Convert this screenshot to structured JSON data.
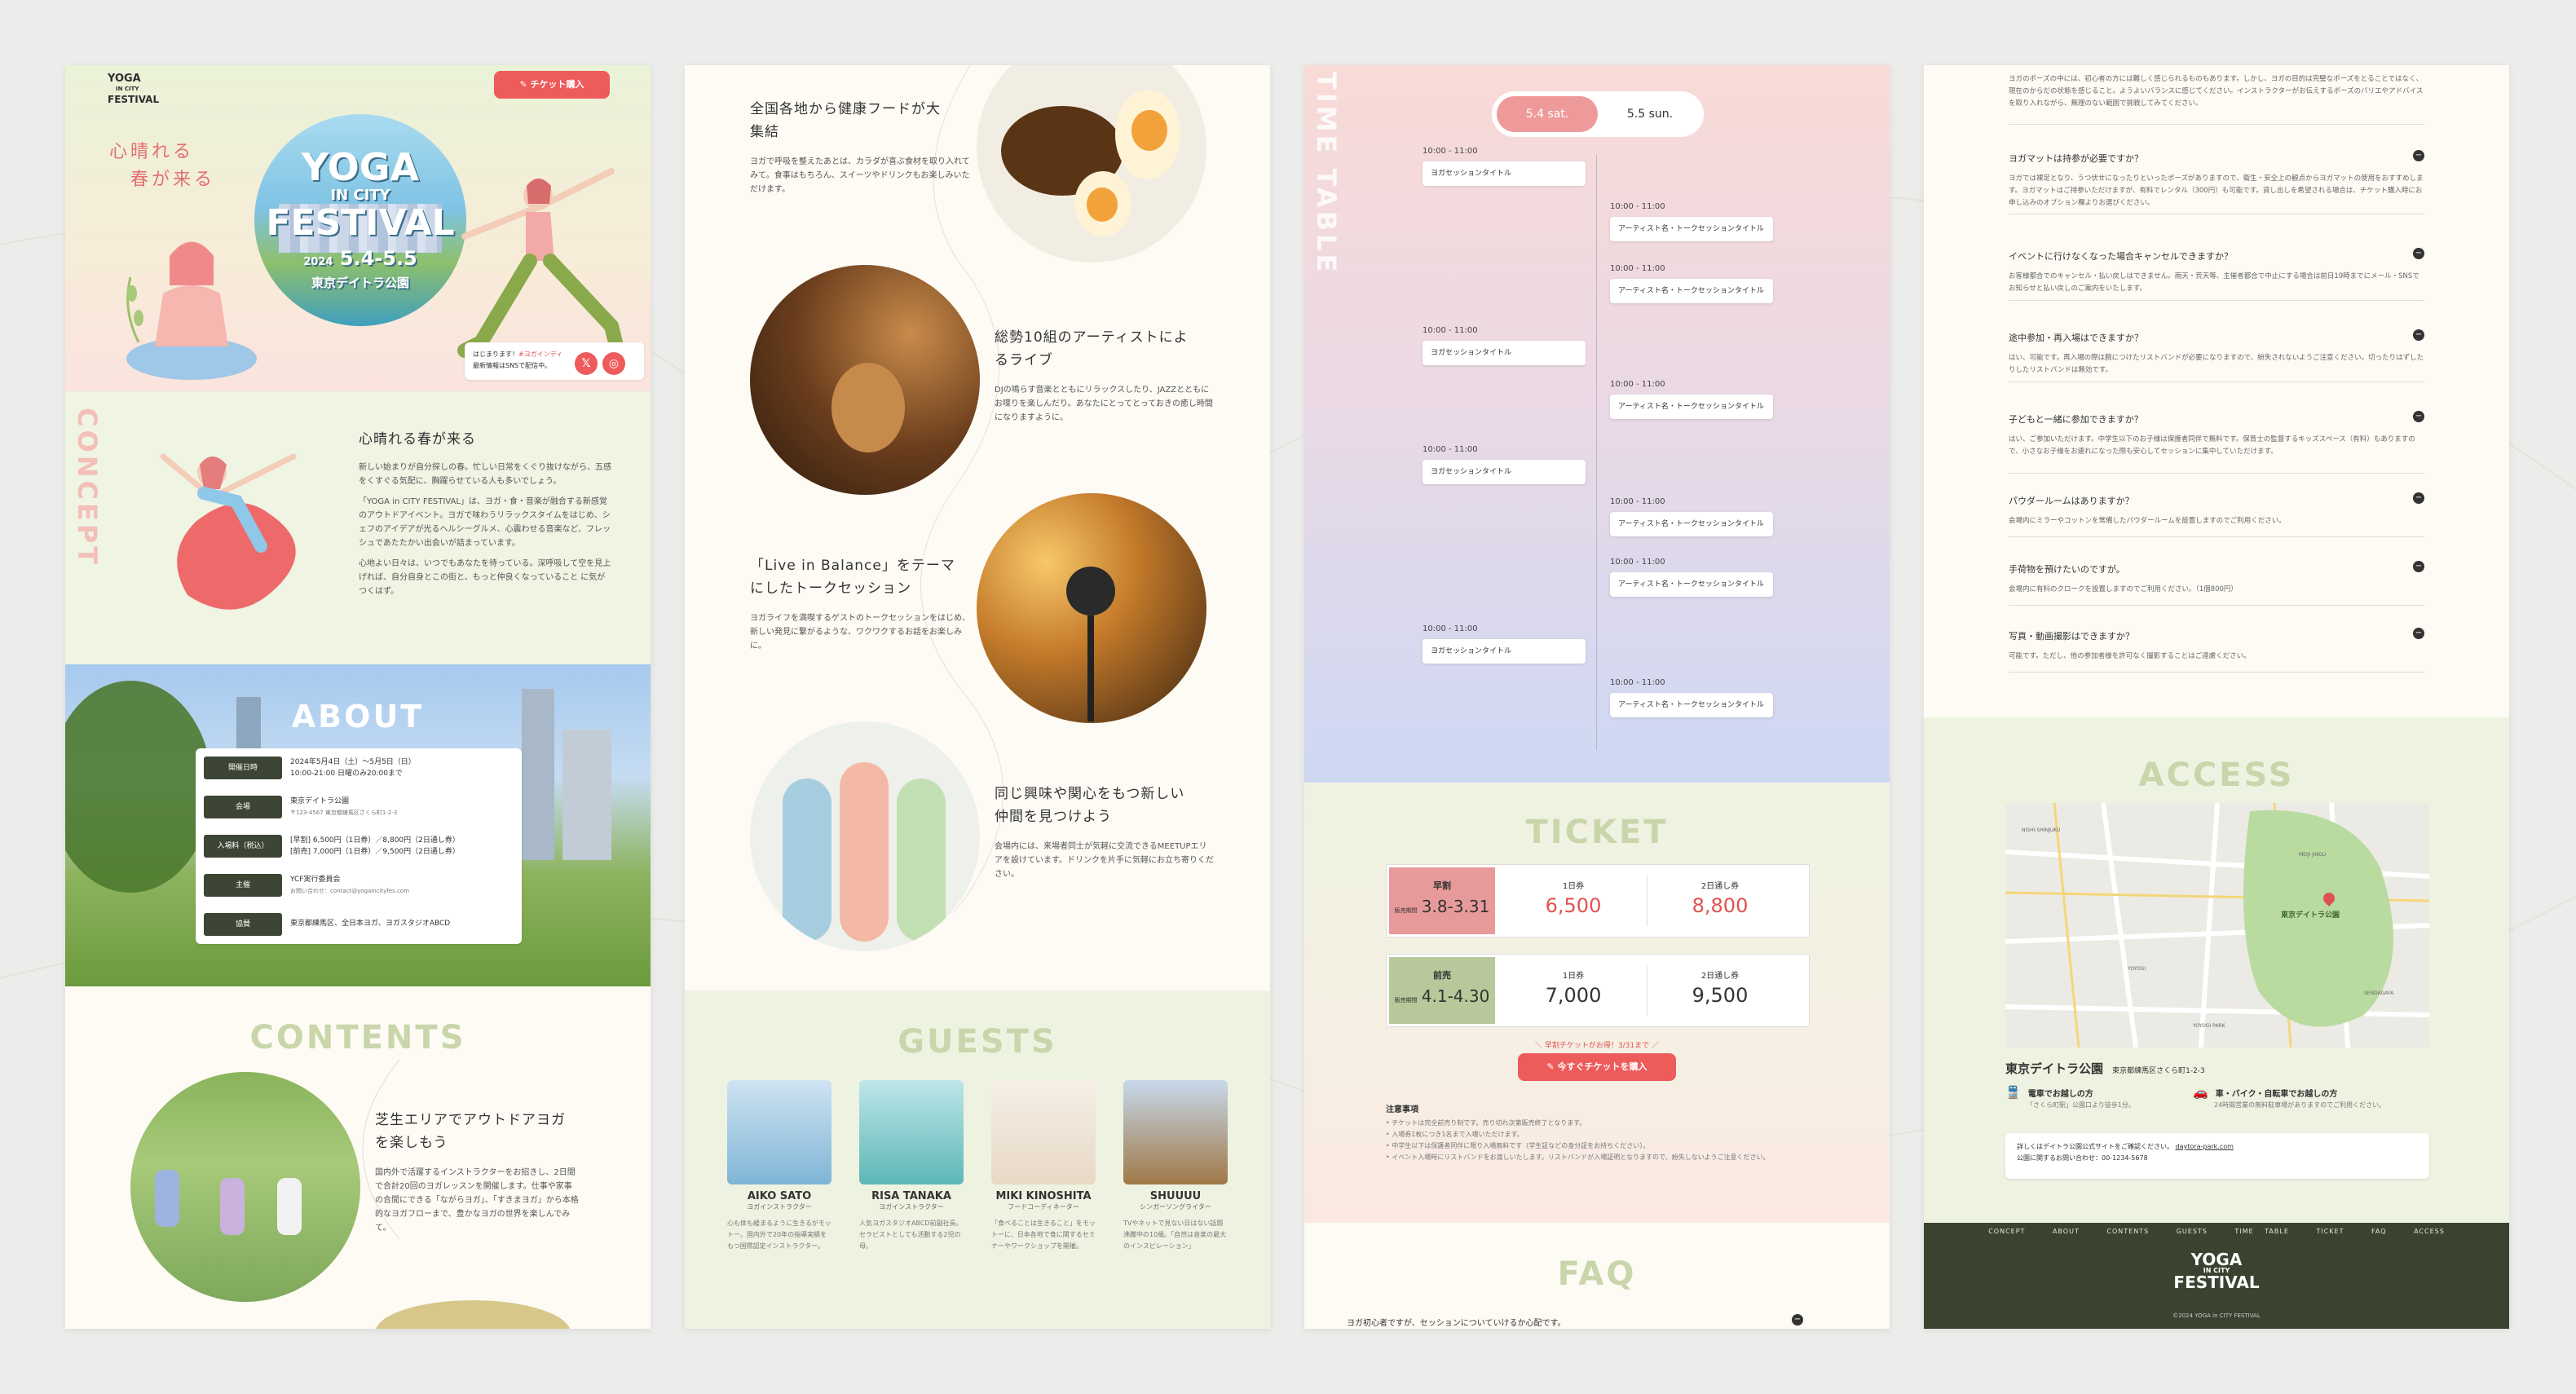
{
  "p1": {
    "logo": {
      "l1": "YOGA",
      "l2": "IN CITY",
      "l3": "FESTIVAL"
    },
    "ticket_button": "チケット購入",
    "hero_tagline": [
      "心晴れる",
      "春が来る"
    ],
    "hero_logo": {
      "l1": "YOGA",
      "l2": "IN CITY",
      "l3": "FESTIVAL",
      "year": "2024",
      "dates": "5.4-5.5",
      "venue": "東京デイトラ公園"
    },
    "news_card": {
      "line1": "はじまります！",
      "link": "#ヨガインディ",
      "line2": "最新情報はSNSで配信中。"
    },
    "concept_vertical": "CONCEPT",
    "concept_title": "心晴れる春が来る",
    "concept_paragraphs": [
      "新しい始まりが自分探しの春。忙しい日常をくぐり抜けながら、五感をくすぐる気配に、胸躍らせている人も多いでしょう。",
      "「YOGA in CITY FESTIVAL」は、ヨガ・食・音楽が融合する新感覚のアウトドアイベント。ヨガで味わうリラックスタイムをはじめ、シェフのアイデアが光るヘルシーグルメ、心震わせる音楽など、フレッシュであたたかい出会いが詰まっています。",
      "心地よい日々は、いつでもあなたを待っている。深呼吸して空を見上げれば、自分自身とこの街と、もっと仲良くなっていること に気がつくはず。"
    ],
    "about_title": "ABOUT",
    "about_rows": [
      {
        "label": "開催日時",
        "value": "2024年5月4日（土）〜5月5日（日）",
        "value2": "10:00-21:00 日曜のみ20:00まで"
      },
      {
        "label": "会場",
        "value": "東京デイトラ公園",
        "value2": "〒123-4567 東京都練馬区さくら町1-2-3"
      },
      {
        "label": "入場料（税込）",
        "value": "[早割] 6,500円（1日券）／8,800円（2日通し券）",
        "value2": "[前売] 7,000円（1日券）／9,500円（2日通し券）"
      },
      {
        "label": "主催",
        "value": "YCF実行委員会",
        "value2": "お問い合わせ：contact@yogaincityfes.com"
      },
      {
        "label": "協賛",
        "value": "東京都練馬区、全日本ヨガ、ヨガスタジオABCD",
        "value2": ""
      }
    ],
    "contents_title": "CONTENTS",
    "contents_item1": {
      "title": [
        "芝生エリアでアウトドアヨガ",
        "を楽しもう"
      ],
      "desc": "国内外で活躍するインストラクターをお招きし、2日間で合計20回のヨガレッスンを開催します。仕事や家事の合間にできる「ながらヨガ」、「すきまヨガ」から本格的なヨガフローまで、豊かなヨガの世界を楽しんでみて。"
    }
  },
  "p2": {
    "items": [
      {
        "title": [
          "全国各地から健康フードが大",
          "集結"
        ],
        "desc": "ヨガで呼吸を整えたあとは、カラダが喜ぶ食材を取り入れてみて。食事はもちろん、スイーツやドリンクもお楽しみいただけます。"
      },
      {
        "title": [
          "総勢10組のアーティストによ",
          "るライブ"
        ],
        "desc": "DJの鳴らす音楽とともにリラックスしたり、JAZZとともにお喋りを楽しんだり。あなたにとってとっておきの癒し時間になりますように。"
      },
      {
        "title": [
          "「Live in Balance」をテーマ",
          "にしたトークセッション"
        ],
        "desc": "ヨガライフを満喫するゲストのトークセッションをはじめ、新しい発見に繋がるような、ワクワクするお話をお楽しみに。"
      },
      {
        "title": [
          "同じ興味や関心をもつ新しい",
          "仲間を見つけよう"
        ],
        "desc": "会場内には、来場者同士が気軽に交流できるMEETUPエリアを設けています。ドリンクを片手に気軽にお立ち寄りください。"
      }
    ],
    "guests_title": "GUESTS",
    "guests": [
      {
        "name": "AIKO SATO",
        "role": "ヨガインストラクター",
        "desc": "心も体も緩まるように生きるがモットー。国内外で20年の指導実績をもつ国際認定インストラクター。"
      },
      {
        "name": "RISA TANAKA",
        "role": "ヨガインストラクター",
        "desc": "人気ヨガスタジオABCD前副社長。セラピストとしても活動する2児の母。"
      },
      {
        "name": "MIKI KINOSHITA",
        "role": "フードコーディネーター",
        "desc": "「食べることは生きること」をモットーに、日本各地で食に関するセミナーやワークショップを開催。"
      },
      {
        "name": "SHUUUU",
        "role": "シンガーソングライター",
        "desc": "TVやネットで見ない日はない話題沸騰中の10歳。「自然は音楽の最大のインスピレーション」"
      }
    ]
  },
  "p3": {
    "timetable_vertical": "TIME TABLE",
    "tabs": [
      "5.4 sat.",
      "5.5 sun."
    ],
    "left_slots": [
      {
        "time": "10:00 - 11:00",
        "title": "ヨガセッションタイトル"
      },
      {
        "time": "10:00 - 11:00",
        "title": "ヨガセッションタイトル"
      },
      {
        "time": "10:00 - 11:00",
        "title": "ヨガセッションタイトル"
      },
      {
        "time": "10:00 - 11:00",
        "title": "ヨガセッションタイトル"
      }
    ],
    "right_slots": [
      {
        "time": "10:00 - 11:00",
        "title": "アーティスト名・トークセッションタイトル"
      },
      {
        "time": "10:00 - 11:00",
        "title": "アーティスト名・トークセッションタイトル"
      },
      {
        "time": "10:00 - 11:00",
        "title": "アーティスト名・トークセッションタイトル"
      },
      {
        "time": "10:00 - 11:00",
        "title": "アーティスト名・トークセッションタイトル"
      },
      {
        "time": "10:00 - 11:00",
        "title": "アーティスト名・トークセッションタイトル"
      },
      {
        "time": "10:00 - 11:00",
        "title": "アーティスト名・トークセッションタイトル"
      }
    ],
    "ticket_title": "TICKET",
    "ticket_rows": [
      {
        "label": "早割",
        "period_label": "販売期間",
        "period": "3.8-3.31",
        "day_label": "1日券",
        "day_price": "6,500",
        "two_label": "2日通し券",
        "two_price": "8,800"
      },
      {
        "label": "前売",
        "period_label": "販売期間",
        "period": "4.1-4.30",
        "day_label": "1日券",
        "day_price": "7,000",
        "two_label": "2日通し券",
        "two_price": "9,500"
      }
    ],
    "yen": "円",
    "early_note": "＼ 早割チケットがお得！3/31まで ／",
    "buy_button": "今すぐチケットを購入",
    "notes_title": "注意事項",
    "notes": [
      "チケットは完全前売り制です。売り切れ次第販売終了となります。",
      "入場券1枚につき1名まで入場いただけます。",
      "中学生以下は保護者同伴に限り入場無料です（学生証などの身分証をお持ちください）。",
      "イベント入場時にリストバンドをお渡しいたします。リストバンドが入場証明となりますので、紛失しないようご注意ください。"
    ],
    "faq_title": "FAQ",
    "faq_first": "ヨガ初心者ですが、セッションについていけるか心配です。"
  },
  "p4": {
    "top_answer": "ヨガのポーズの中には、初心者の方には難しく感じられるものもあります。しかし、ヨガの目的は完璧なポーズをとることではなく、現在のからだの状態を感じること。ようよいバランスに感じてください。インストラクターがお伝えするポーズのバリエやアドバイスを取り入れながら、無理のない範囲で挑戦してみてください。",
    "faqs": [
      {
        "q": "ヨガマットは持参が必要ですか？",
        "a": "ヨガでは裸足となり、うつ伏せになったりといったポーズがありますので、衛生・安全上の観点からヨガマットの使用をおすすめします。ヨガマットはご持参いただけますが、有料でレンタル（300円）も可能です。貸し出しを希望される場合は、チケット購入時にお申し込みのオプション欄よりお選びください。"
      },
      {
        "q": "イベントに行けなくなった場合キャンセルできますか？",
        "a": "お客様都合でのキャンセル・払い戻しはできません。雨天・荒天等、主催者都合で中止にする場合は前日19時までにメール・SNSでお知らせと払い戻しのご案内をいたします。"
      },
      {
        "q": "途中参加・再入場はできますか？",
        "a": "はい、可能です。再入場の際は腕につけたリストバンドが必要になりますので、紛失されないようご注意ください。切ったりはずしたりしたリストバンドは無効です。"
      },
      {
        "q": "子どもと一緒に参加できますか？",
        "a": "はい、ご参加いただけます。中学生以下のお子様は保護者同伴で無料です。保育士の監督するキッズスペース（有料）もありますので、小さなお子様をお連れになった際も安心してセッションに集中していただけます。"
      },
      {
        "q": "パウダールームはありますか？",
        "a": "会場内にミラーやコットンを常備したパウダールームを設置しますのでご利用ください。"
      },
      {
        "q": "手荷物を預けたいのですが。",
        "a": "会場内に有料のクロークを設置しますのでご利用ください。（1個800円）"
      },
      {
        "q": "写真・動画撮影はできますか？",
        "a": "可能です。ただし、他の参加者様を許可なく撮影することはご遠慮ください。"
      }
    ],
    "access_title": "ACCESS",
    "map": {
      "park_name": "東京デイトラ公園",
      "streets": [
        "NISHI-SHINJUKU",
        "YOYOGI",
        "SENDAGAYA",
        "YOYOGI PARK",
        "MEIJI JINGU"
      ]
    },
    "venue_name": "東京デイトラ公園",
    "venue_address": "東京都練馬区さくら町1-2-3",
    "by_train": {
      "title": "電車でお越しの方",
      "desc": "「さくら町駅」公園口より徒歩1分。"
    },
    "by_car": {
      "title": "車・バイク・自転車でお越しの方",
      "desc": "24時間営業の無料駐車場がありますのでご利用ください。"
    },
    "info_line1_pre": "詳しくはデイトラ公園公式サイトをご確認ください。",
    "info_link": "daytora-park.com",
    "info_line2": "公園に関するお問い合わせ：00-1234-5678",
    "footer_nav": [
      "CONCEPT",
      "ABOUT",
      "CONTENTS",
      "GUESTS",
      "TIME TABLE",
      "TICKET",
      "FAQ",
      "ACCESS"
    ],
    "footer_logo": {
      "l1": "YOGA",
      "l2": "IN CITY",
      "l3": "FESTIVAL"
    },
    "copyright": "©2024 YOGA in CITY FESTIVAL"
  },
  "colors": {
    "accent_red": "#ee5b5b",
    "sage": "#c9d6ab",
    "footer_dark": "#3a4330",
    "pink": "#f3c9c4"
  }
}
